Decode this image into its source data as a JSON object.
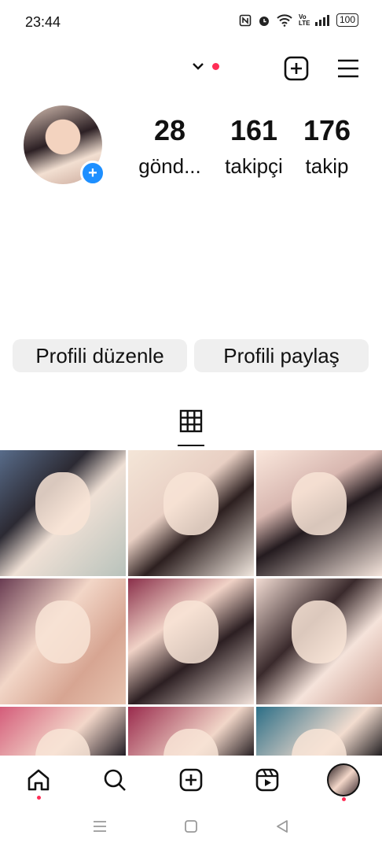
{
  "status_bar": {
    "time": "23:44",
    "net_label": "Vo LTE",
    "battery": "100",
    "icons": [
      "nfc-icon",
      "alarm-icon",
      "wifi-icon",
      "volte-icon",
      "signal-icon",
      "battery-icon"
    ]
  },
  "header": {
    "icons": [
      "chevron-down-icon",
      "notification-dot",
      "new-post-icon",
      "menu-icon"
    ],
    "accent": "#ff2d55"
  },
  "profile": {
    "stats": [
      {
        "value": "28",
        "label": "gönd..."
      },
      {
        "value": "161",
        "label": "takipçi"
      },
      {
        "value": "176",
        "label": "takip"
      }
    ],
    "add_story_color": "#1e8fff"
  },
  "buttons": {
    "edit_profile": "Profili düzenle",
    "share_profile": "Profili paylaş"
  },
  "tabs": {
    "active": "grid-icon"
  },
  "bottom_nav": {
    "items": [
      "home-icon",
      "search-icon",
      "create-icon",
      "reels-icon",
      "profile-avatar"
    ]
  },
  "system_nav": {
    "items": [
      "recent-apps-icon",
      "home-square-icon",
      "back-triangle-icon"
    ]
  }
}
